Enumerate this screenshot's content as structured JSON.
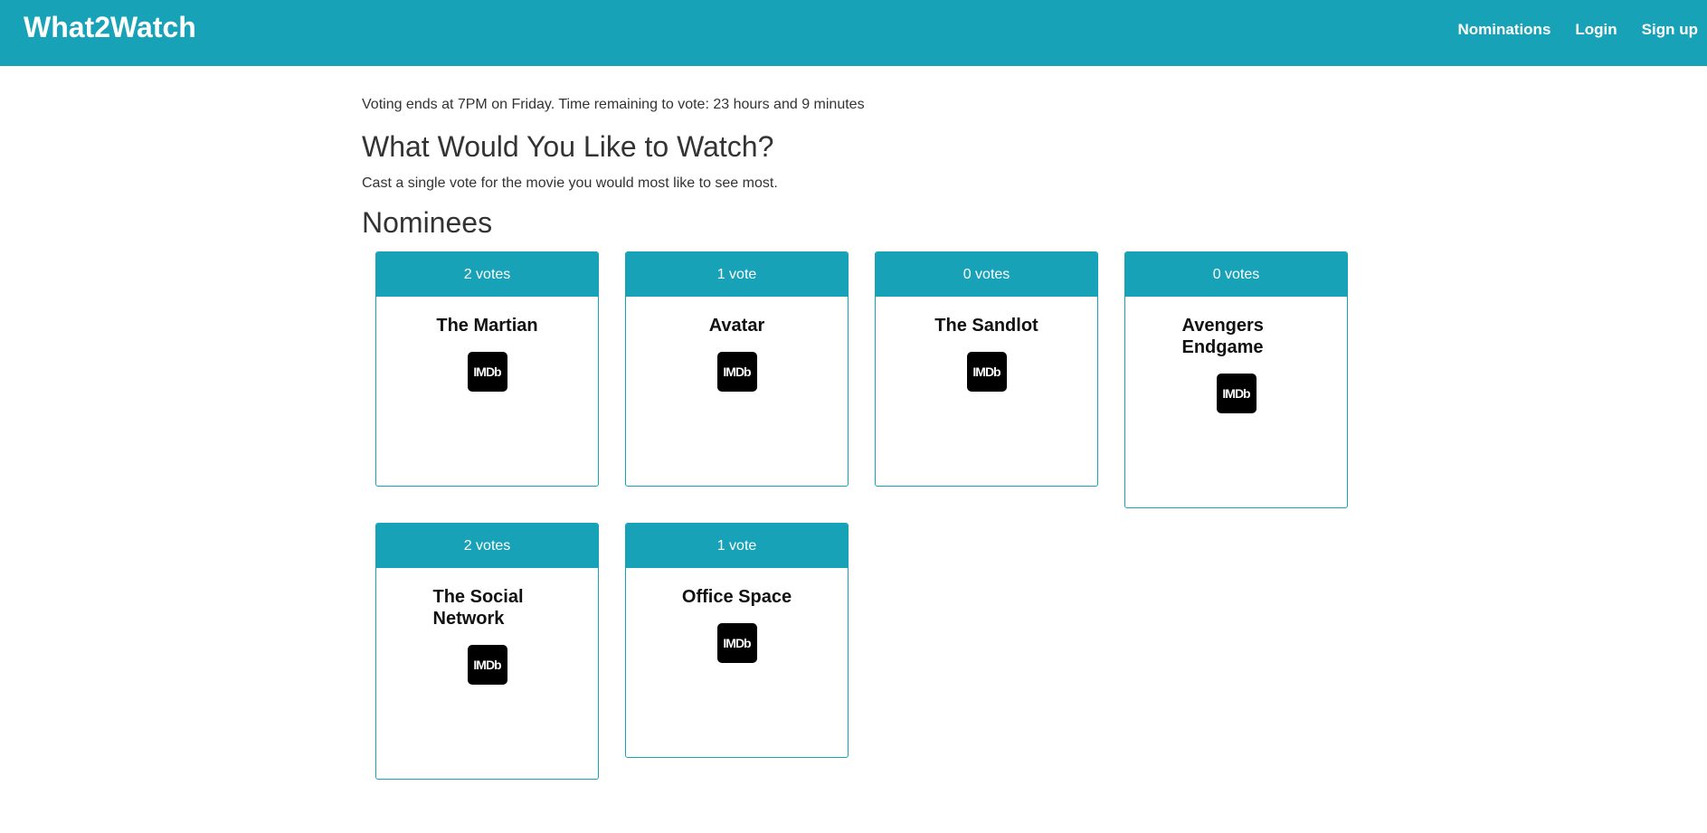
{
  "navbar": {
    "brand": "What2Watch",
    "links": [
      "Nominations",
      "Login",
      "Sign up"
    ]
  },
  "voting_info": "Voting ends at 7PM on Friday. Time remaining to vote: 23 hours and 9 minutes",
  "heading": "What Would You Like to Watch?",
  "subtext": "Cast a single vote for the movie you would most like to see most.",
  "nominees_heading": "Nominees",
  "imdb_label": "IMDb",
  "nominees": [
    {
      "votes": "2 votes",
      "title": "The Martian"
    },
    {
      "votes": "1 vote",
      "title": "Avatar"
    },
    {
      "votes": "0 votes",
      "title": "The Sandlot"
    },
    {
      "votes": "0 votes",
      "title": "Avengers Endgame"
    },
    {
      "votes": "2 votes",
      "title": "The Social Network"
    },
    {
      "votes": "1 vote",
      "title": "Office Space"
    }
  ],
  "colors": {
    "accent": "#17a2b8",
    "text": "#333333",
    "imdb_icon_bg": "#000000"
  }
}
